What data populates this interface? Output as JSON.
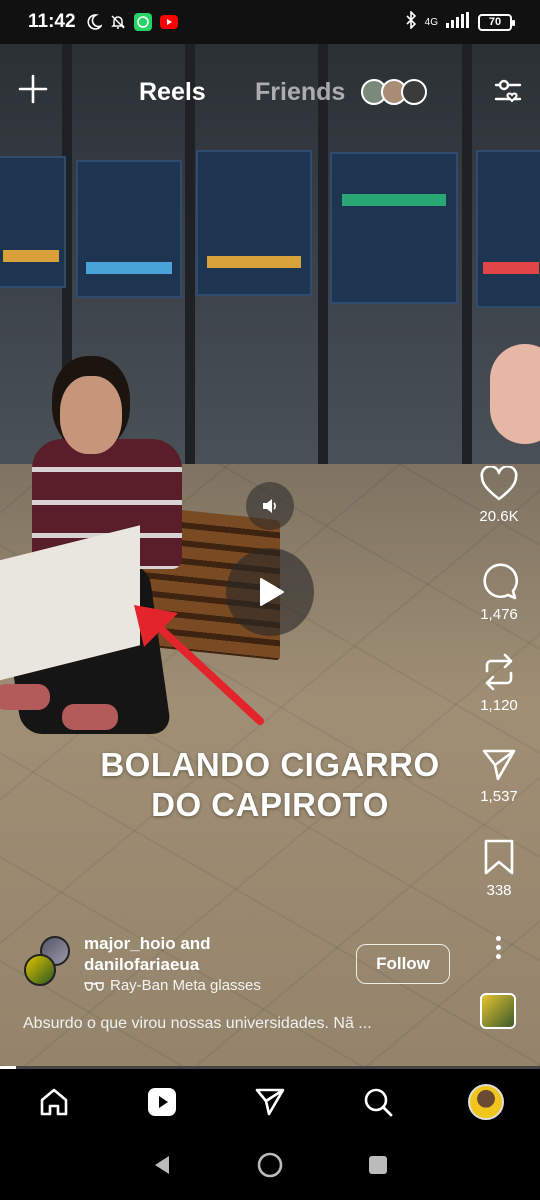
{
  "status_bar": {
    "time": "11:42",
    "network": "4G",
    "battery": "70"
  },
  "top": {
    "tab_reels": "Reels",
    "tab_friends": "Friends"
  },
  "video": {
    "caption_line1": "BOLANDO CIGARRO",
    "caption_line2": "DO CAPIROTO",
    "progress": 0.03
  },
  "actions": {
    "likes": "20.6K",
    "comments": "1,476",
    "reposts": "1,120",
    "shares": "1,537",
    "saves": "338"
  },
  "author": {
    "line1": "major_hoio and",
    "line2": "danilofariaeua",
    "device": "Ray-Ban Meta glasses",
    "follow_label": "Follow"
  },
  "description": "Absurdo o que virou nossas universidades. Nã ...",
  "colors": {
    "background": "#000000",
    "arrow": "#e3242b"
  }
}
